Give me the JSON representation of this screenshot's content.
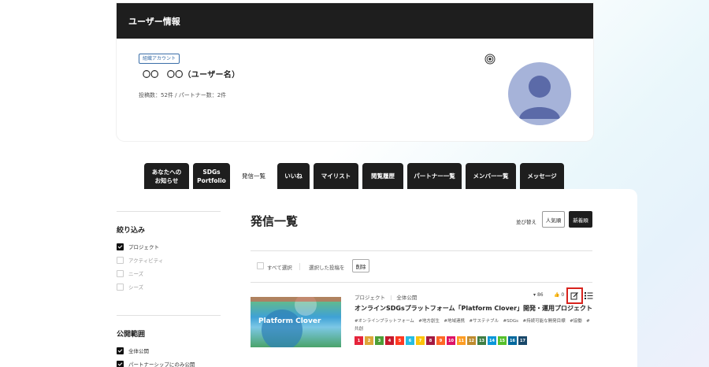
{
  "user": {
    "header_title": "ユーザー情報",
    "badge": "組織アカウント",
    "name": "〇〇　〇〇（ユーザー名）",
    "counts": "投稿数：52件 / パートナー数：2件"
  },
  "tabs": [
    {
      "label": "あなたへの\nお知らせ",
      "active": false
    },
    {
      "label": "SDGs\nPortfolio",
      "active": false
    },
    {
      "label": "発信一覧",
      "active": true
    },
    {
      "label": "いいね",
      "active": false
    },
    {
      "label": "マイリスト",
      "active": false
    },
    {
      "label": "閲覧履歴",
      "active": false
    },
    {
      "label": "パートナー一覧",
      "active": false
    },
    {
      "label": "メンバー一覧",
      "active": false
    },
    {
      "label": "メッセージ",
      "active": false
    }
  ],
  "filters": {
    "title": "絞り込み",
    "items": [
      {
        "label": "プロジェクト",
        "checked": true
      },
      {
        "label": "アクティビティ",
        "checked": false
      },
      {
        "label": "ニーズ",
        "checked": false
      },
      {
        "label": "シーズ",
        "checked": false
      }
    ]
  },
  "visibility": {
    "title": "公開範囲",
    "items": [
      {
        "label": "全体公開",
        "checked": true
      },
      {
        "label": "パートナーシップにのみ公開",
        "checked": true
      }
    ]
  },
  "list": {
    "title": "発信一覧",
    "sort_label": "並び替え",
    "sort_popular": "人気順",
    "sort_newest": "新着順",
    "select_all": "すべて選択",
    "selected_posts": "選択した投稿を",
    "delete": "削除"
  },
  "post": {
    "thumb_text": "Platform Clover",
    "category": "プロジェクト",
    "visibility": "全体公開",
    "title": "オンラインSDGsプラットフォーム「Platform Clover」開発・運用プロジェクト",
    "tags": "#オンラインプラットフォーム　#地方創生　#地域連携　#サステナブル　#SDGs　#持続可能な開発目標　#協働　#共創",
    "views": "86",
    "likes": "0",
    "sdgs": [
      "1",
      "2",
      "3",
      "4",
      "5",
      "6",
      "7",
      "8",
      "9",
      "10",
      "11",
      "12",
      "13",
      "14",
      "15",
      "16",
      "17"
    ]
  },
  "colors": {
    "sdg": [
      "#e5243b",
      "#dda63a",
      "#4c9f38",
      "#c5192d",
      "#ff3a21",
      "#26bde2",
      "#fcc30b",
      "#a21942",
      "#fd6925",
      "#dd1367",
      "#fd9d24",
      "#bf8b2e",
      "#3f7e44",
      "#0a97d9",
      "#56c02b",
      "#00689d",
      "#19486a"
    ],
    "highlight": "#d8231d",
    "dark": "#1e1e1e"
  },
  "icons": [
    "target-icon",
    "avatar-person-icon",
    "view-count-icon",
    "like-icon",
    "edit-icon",
    "list-icon",
    "checkbox-icon"
  ]
}
